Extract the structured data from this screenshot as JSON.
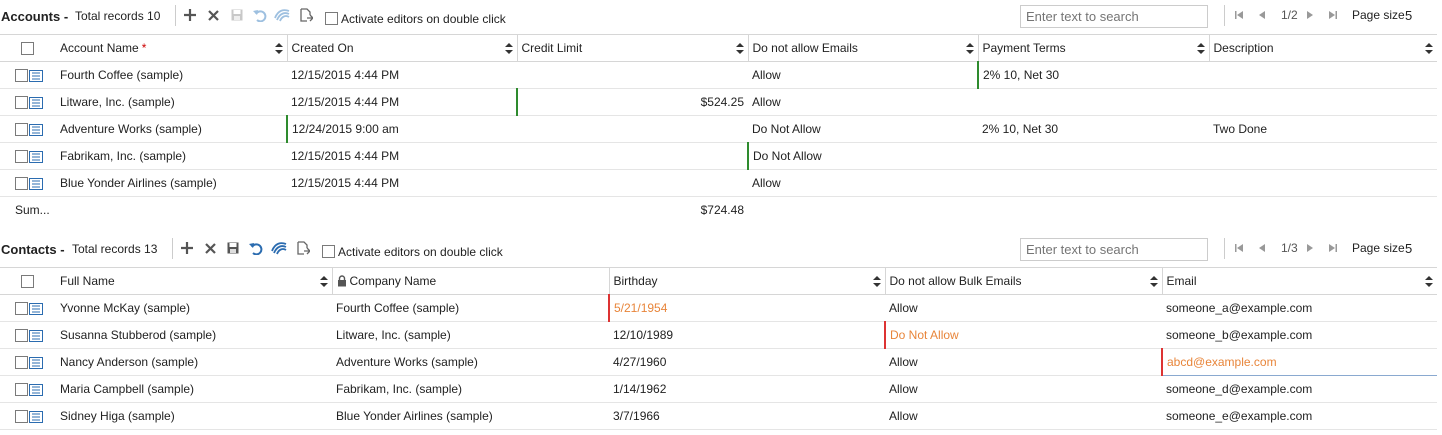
{
  "accounts": {
    "title": "Accounts",
    "dash": "-",
    "records_label": "Total records 10",
    "activate_label": "Activate editors on double click",
    "search_placeholder": "Enter text to search",
    "page_indicator": "1/2",
    "page_size_label": "Page size",
    "page_size_value": "5",
    "columns": [
      "Account Name",
      "Created On",
      "Credit Limit",
      "Do not allow Emails",
      "Payment Terms",
      "Description"
    ],
    "rows": [
      [
        "Fourth Coffee (sample)",
        "12/15/2015 4:44 PM",
        "",
        "Allow",
        "2% 10, Net 30",
        ""
      ],
      [
        "Litware, Inc. (sample)",
        "12/15/2015 4:44 PM",
        "$524.25",
        "Allow",
        "",
        ""
      ],
      [
        "Adventure Works (sample)",
        "12/24/2015 9:00 am",
        "",
        "Do Not Allow",
        "2% 10, Net 30",
        "Two Done"
      ],
      [
        "Fabrikam, Inc. (sample)",
        "12/15/2015 4:44 PM",
        "",
        "Do Not Allow",
        "",
        ""
      ],
      [
        "Blue Yonder Airlines (sample)",
        "12/15/2015 4:44 PM",
        "",
        "Allow",
        "",
        ""
      ]
    ],
    "summary_label": "Sum...",
    "summary_value": "$724.48"
  },
  "contacts": {
    "title": "Contacts",
    "dash": "-",
    "records_label": "Total records 13",
    "activate_label": "Activate editors on double click",
    "search_placeholder": "Enter text to search",
    "page_indicator": "1/3",
    "page_size_label": "Page size",
    "page_size_value": "5",
    "columns": [
      "Full Name",
      "Company Name",
      "Birthday",
      "Do not allow Bulk Emails",
      "Email"
    ],
    "rows": [
      [
        "Yvonne McKay (sample)",
        "Fourth Coffee (sample)",
        "5/21/1954",
        "Allow",
        "someone_a@example.com"
      ],
      [
        "Susanna Stubberod (sample)",
        "Litware, Inc. (sample)",
        "12/10/1989",
        "Do Not Allow",
        "someone_b@example.com"
      ],
      [
        "Nancy Anderson (sample)",
        "Adventure Works (sample)",
        "4/27/1960",
        "Allow",
        "abcd@example.com"
      ],
      [
        "Maria Campbell (sample)",
        "Fabrikam, Inc. (sample)",
        "1/14/1962",
        "Allow",
        "someone_d@example.com"
      ],
      [
        "Sidney Higa (sample)",
        "Blue Yonder Airlines (sample)",
        "3/7/1966",
        "Allow",
        "someone_e@example.com"
      ]
    ]
  },
  "colors": {
    "accent_blue": "#2b6cb0",
    "changed_marker": "#2e8b2e",
    "error_marker": "#d33333",
    "error_text": "#e8853a"
  },
  "icons": [
    "add-icon",
    "delete-icon",
    "save-icon",
    "undo-icon",
    "refresh-icon",
    "export-icon",
    "first-page-icon",
    "prev-page-icon",
    "next-page-icon",
    "last-page-icon",
    "sort-icon",
    "edit-record-icon",
    "lock-icon"
  ]
}
